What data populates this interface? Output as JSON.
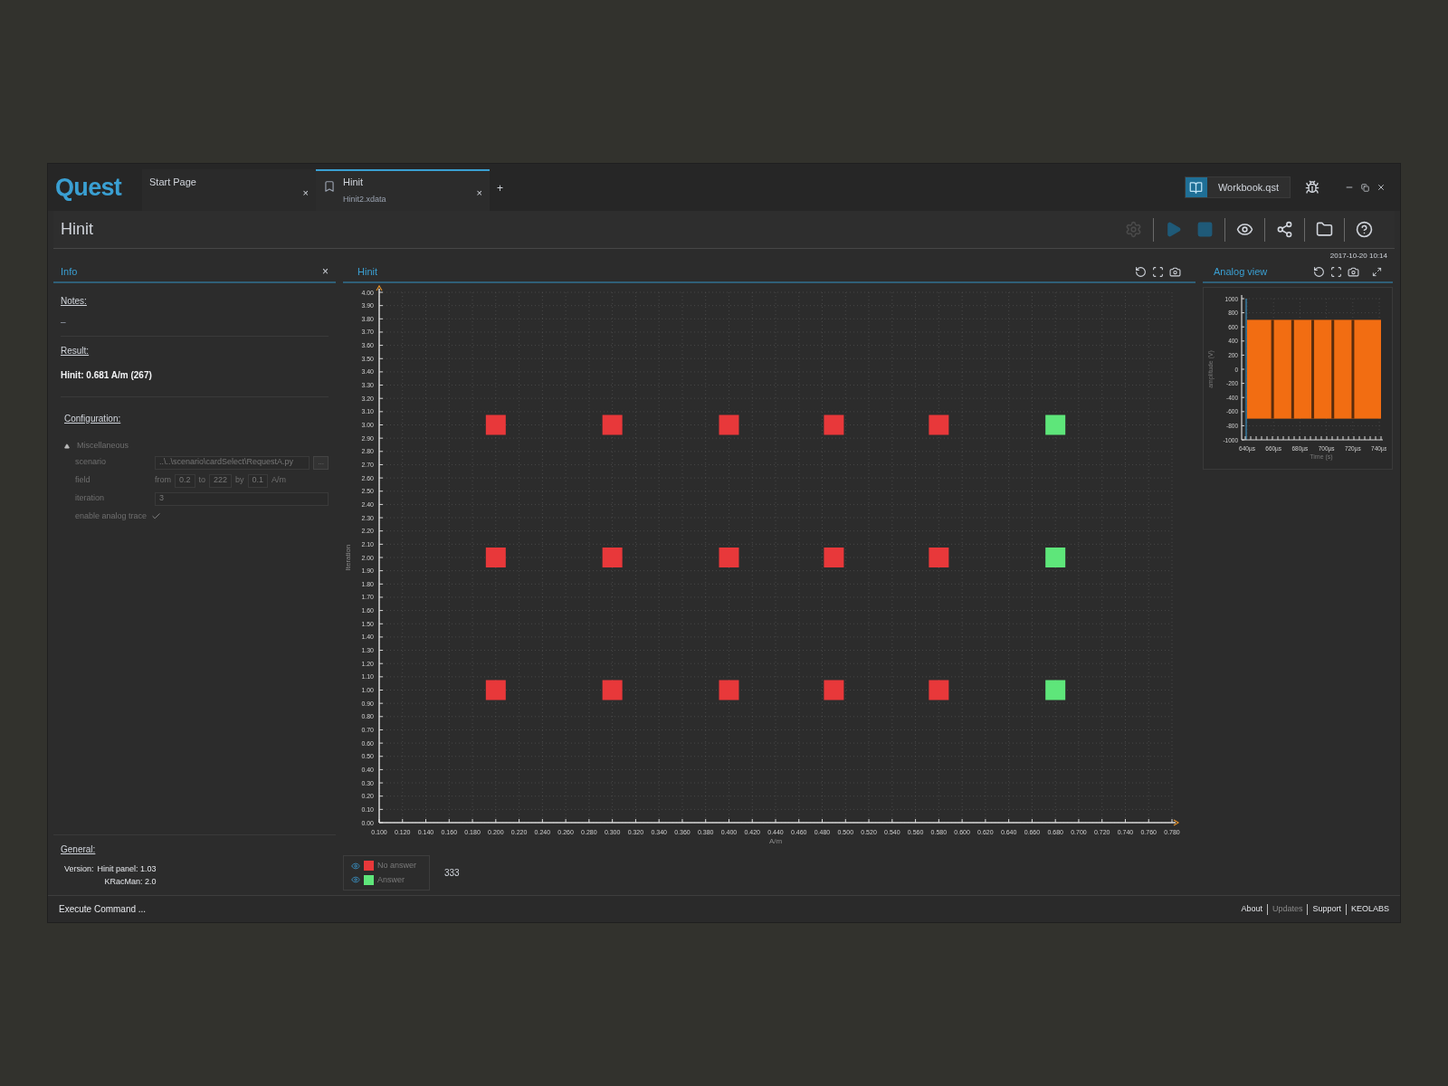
{
  "logo": "Quest",
  "tabs": [
    {
      "title": "Start Page",
      "selected": false,
      "close": "×"
    },
    {
      "title": "Hinit",
      "subtitle": "Hinit2.xdata",
      "selected": true,
      "close": "×"
    }
  ],
  "add_tab": "+",
  "workbook": "Workbook.qst",
  "page_title": "Hinit",
  "toolbar": [
    {
      "kind": "gear",
      "disabled": true
    },
    {
      "kind": "play",
      "disabled": true
    },
    {
      "kind": "stop",
      "disabled": true
    },
    {
      "kind": "eye",
      "disabled": false
    },
    {
      "kind": "share",
      "disabled": false
    },
    {
      "kind": "folder",
      "disabled": false
    },
    {
      "kind": "help",
      "disabled": false
    }
  ],
  "timestamp": "2017-10-20 10:14",
  "info_panel": {
    "tab": "Info",
    "close": "×",
    "notes_heading": "Notes:",
    "notes": "–",
    "result_heading": "Result:",
    "result": "Hinit: 0.681 A/m (267)",
    "configuration_heading": "Configuration:",
    "group": {
      "label": "Miscellaneous",
      "expanded": true
    },
    "settings": [
      {
        "kind": "path",
        "label": "scenario",
        "value": "..\\..\\scenario\\cardSelect\\RequestA.py",
        "browse": "..."
      },
      {
        "kind": "range",
        "label": "field",
        "from_label": "from",
        "from": "0.2",
        "to_label": "to",
        "to": "222",
        "by_label": "by",
        "by": "0.1",
        "unit": "A/m"
      },
      {
        "kind": "text",
        "label": "iteration",
        "value": "3"
      },
      {
        "kind": "check",
        "label": "enable analog trace",
        "checked": true
      }
    ],
    "general_heading": "General:",
    "version_label": "Version:",
    "versions": [
      "Hinit panel: 1.03",
      "KRacMan: 2.0"
    ]
  },
  "hinit_panel": {
    "title": "Hinit",
    "chart_data": {
      "type": "scatter",
      "grid": true,
      "xlabel": "A/m",
      "ylabel": "Iteration",
      "xlim": [
        0.1,
        0.78
      ],
      "ylim": [
        0,
        4
      ],
      "xticks": [
        {
          "value": 0.1,
          "label": "0.100"
        },
        {
          "value": 0.12,
          "label": "0.120"
        },
        {
          "value": 0.14,
          "label": "0.140"
        },
        {
          "value": 0.16,
          "label": "0.160"
        },
        {
          "value": 0.18,
          "label": "0.180"
        },
        {
          "value": 0.2,
          "label": "0.200"
        },
        {
          "value": 0.22,
          "label": "0.220"
        },
        {
          "value": 0.24,
          "label": "0.240"
        },
        {
          "value": 0.26,
          "label": "0.260"
        },
        {
          "value": 0.28,
          "label": "0.280"
        },
        {
          "value": 0.3,
          "label": "0.300"
        },
        {
          "value": 0.32,
          "label": "0.320"
        },
        {
          "value": 0.34,
          "label": "0.340"
        },
        {
          "value": 0.36,
          "label": "0.360"
        },
        {
          "value": 0.38,
          "label": "0.380"
        },
        {
          "value": 0.4,
          "label": "0.400"
        },
        {
          "value": 0.42,
          "label": "0.420"
        },
        {
          "value": 0.44,
          "label": "0.440"
        },
        {
          "value": 0.46,
          "label": "0.460"
        },
        {
          "value": 0.48,
          "label": "0.480"
        },
        {
          "value": 0.5,
          "label": "0.500"
        },
        {
          "value": 0.52,
          "label": "0.520"
        },
        {
          "value": 0.54,
          "label": "0.540"
        },
        {
          "value": 0.56,
          "label": "0.560"
        },
        {
          "value": 0.58,
          "label": "0.580"
        },
        {
          "value": 0.6,
          "label": "0.600"
        },
        {
          "value": 0.62,
          "label": "0.620"
        },
        {
          "value": 0.64,
          "label": "0.640"
        },
        {
          "value": 0.66,
          "label": "0.660"
        },
        {
          "value": 0.68,
          "label": "0.680"
        },
        {
          "value": 0.7,
          "label": "0.700"
        },
        {
          "value": 0.72,
          "label": "0.720"
        },
        {
          "value": 0.74,
          "label": "0.740"
        },
        {
          "value": 0.76,
          "label": "0.760"
        },
        {
          "value": 0.78,
          "label": "0.780"
        }
      ],
      "yticks": [
        {
          "value": 0,
          "label": "0.00"
        },
        {
          "value": 0.1,
          "label": "0.10"
        },
        {
          "value": 0.2,
          "label": "0.20"
        },
        {
          "value": 0.3,
          "label": "0.30"
        },
        {
          "value": 0.4,
          "label": "0.40"
        },
        {
          "value": 0.5,
          "label": "0.50"
        },
        {
          "value": 0.6,
          "label": "0.60"
        },
        {
          "value": 0.7,
          "label": "0.70"
        },
        {
          "value": 0.8,
          "label": "0.80"
        },
        {
          "value": 0.9,
          "label": "0.90"
        },
        {
          "value": 1,
          "label": "1.00"
        },
        {
          "value": 1.1,
          "label": "1.10"
        },
        {
          "value": 1.2,
          "label": "1.20"
        },
        {
          "value": 1.3,
          "label": "1.30"
        },
        {
          "value": 1.4,
          "label": "1.40"
        },
        {
          "value": 1.5,
          "label": "1.50"
        },
        {
          "value": 1.6,
          "label": "1.60"
        },
        {
          "value": 1.7,
          "label": "1.70"
        },
        {
          "value": 1.8,
          "label": "1.80"
        },
        {
          "value": 1.9,
          "label": "1.90"
        },
        {
          "value": 2,
          "label": "2.00"
        },
        {
          "value": 2.1,
          "label": "2.10"
        },
        {
          "value": 2.2,
          "label": "2.20"
        },
        {
          "value": 2.3,
          "label": "2.30"
        },
        {
          "value": 2.4,
          "label": "2.40"
        },
        {
          "value": 2.5,
          "label": "2.50"
        },
        {
          "value": 2.6,
          "label": "2.60"
        },
        {
          "value": 2.7,
          "label": "2.70"
        },
        {
          "value": 2.8,
          "label": "2.80"
        },
        {
          "value": 2.9,
          "label": "2.90"
        },
        {
          "value": 3,
          "label": "3.00"
        },
        {
          "value": 3.1,
          "label": "3.10"
        },
        {
          "value": 3.2,
          "label": "3.20"
        },
        {
          "value": 3.3,
          "label": "3.30"
        },
        {
          "value": 3.4,
          "label": "3.40"
        },
        {
          "value": 3.5,
          "label": "3.50"
        },
        {
          "value": 3.6,
          "label": "3.60"
        },
        {
          "value": 3.7,
          "label": "3.70"
        },
        {
          "value": 3.8,
          "label": "3.80"
        },
        {
          "value": 3.9,
          "label": "3.90"
        },
        {
          "value": 4,
          "label": "4.00"
        }
      ],
      "series": [
        {
          "name": "No answer",
          "color": "#e8383a",
          "x": [
            0.2,
            0.3,
            0.4,
            0.49,
            0.58,
            0.2,
            0.3,
            0.4,
            0.49,
            0.58,
            0.2,
            0.3,
            0.4,
            0.49,
            0.58
          ],
          "values": [
            3,
            3,
            3,
            3,
            3,
            2,
            2,
            2,
            2,
            2,
            1,
            1,
            1,
            1,
            1
          ]
        },
        {
          "name": "Answer",
          "color": "#5ee67a",
          "x": [
            0.68,
            0.68,
            0.68
          ],
          "values": [
            3,
            2,
            1
          ]
        }
      ]
    },
    "count": "333"
  },
  "analog_panel": {
    "title": "Analog view",
    "ylabel": "amplitude (V)",
    "xlabel": "Time (s)",
    "yticks": [
      "1000",
      "800",
      "600",
      "400",
      "200",
      "0",
      "-200",
      "-400",
      "-600",
      "-800",
      "-1000"
    ],
    "xticks": [
      "640µs",
      "660µs",
      "680µs",
      "700µs",
      "720µs",
      "740µs"
    ]
  },
  "status_bar": {
    "command": "Execute Command ...",
    "links": [
      {
        "label": "About",
        "disabled": false
      },
      {
        "label": "Updates",
        "disabled": true
      },
      {
        "label": "Support",
        "disabled": false
      },
      {
        "label": "KEOLABS",
        "disabled": false
      }
    ]
  }
}
